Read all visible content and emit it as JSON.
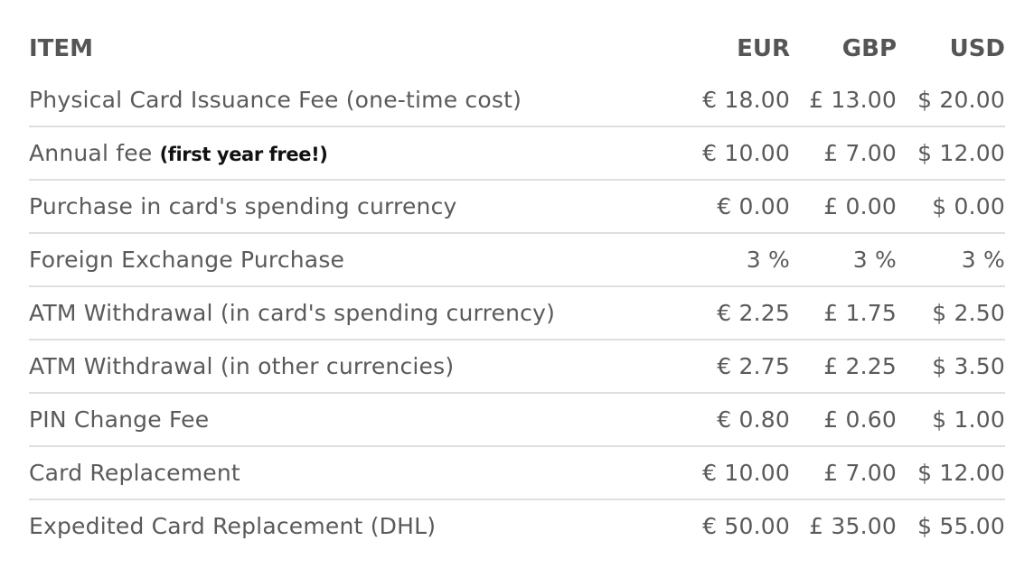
{
  "header": {
    "item": "ITEM",
    "eur": "EUR",
    "gbp": "GBP",
    "usd": "USD"
  },
  "rows": [
    {
      "item": "Physical Card Issuance Fee (one-time cost)",
      "note": "",
      "eur": "€ 18.00",
      "gbp": "£ 13.00",
      "usd": "$ 20.00"
    },
    {
      "item": "Annual fee",
      "note": "(first year free!)",
      "eur": "€ 10.00",
      "gbp": "£ 7.00",
      "usd": "$ 12.00"
    },
    {
      "item": "Purchase in card's spending currency",
      "note": "",
      "eur": "€ 0.00",
      "gbp": "£ 0.00",
      "usd": "$ 0.00"
    },
    {
      "item": "Foreign Exchange Purchase",
      "note": "",
      "eur": "3 %",
      "gbp": "3 %",
      "usd": "3 %"
    },
    {
      "item": "ATM Withdrawal (in card's spending currency)",
      "note": "",
      "eur": "€ 2.25",
      "gbp": "£ 1.75",
      "usd": "$ 2.50"
    },
    {
      "item": "ATM Withdrawal (in other currencies)",
      "note": "",
      "eur": "€ 2.75",
      "gbp": "£ 2.25",
      "usd": "$ 3.50"
    },
    {
      "item": "PIN Change Fee",
      "note": "",
      "eur": "€ 0.80",
      "gbp": "£ 0.60",
      "usd": "$ 1.00"
    },
    {
      "item": "Card Replacement",
      "note": "",
      "eur": "€ 10.00",
      "gbp": "£ 7.00",
      "usd": "$ 12.00"
    },
    {
      "item": "Expedited Card Replacement (DHL)",
      "note": "",
      "eur": "€ 50.00",
      "gbp": "£ 35.00",
      "usd": "$ 55.00"
    }
  ]
}
